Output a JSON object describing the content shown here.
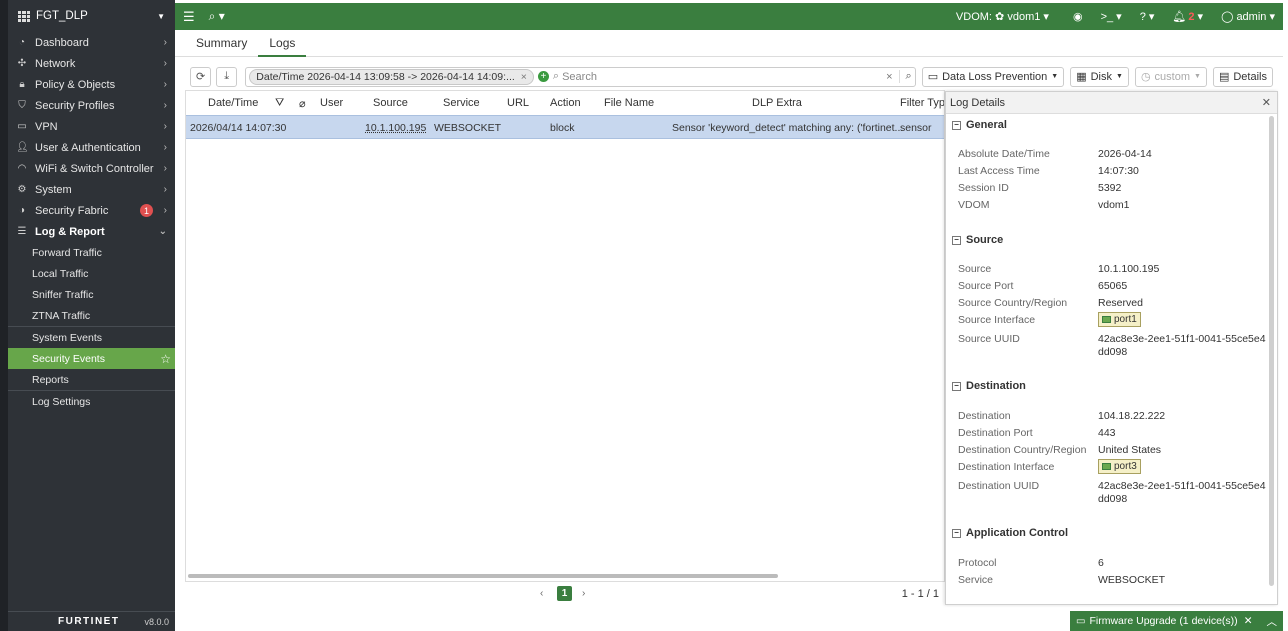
{
  "sidebar": {
    "device": "FGT_DLP",
    "items": [
      {
        "label": "Dashboard",
        "icon": "dashboard-icon"
      },
      {
        "label": "Network",
        "icon": "network-icon"
      },
      {
        "label": "Policy & Objects",
        "icon": "lock-icon"
      },
      {
        "label": "Security Profiles",
        "icon": "shield-icon"
      },
      {
        "label": "VPN",
        "icon": "monitor-icon"
      },
      {
        "label": "User & Authentication",
        "icon": "user-icon"
      },
      {
        "label": "WiFi & Switch Controller",
        "icon": "wifi-icon"
      },
      {
        "label": "System",
        "icon": "gear-icon"
      },
      {
        "label": "Security Fabric",
        "icon": "fabric-icon",
        "badge": "1"
      },
      {
        "label": "Log & Report",
        "icon": "chart-icon"
      }
    ],
    "sub_items": [
      "Forward Traffic",
      "Local Traffic",
      "Sniffer Traffic",
      "ZTNA Traffic",
      "System Events",
      "Security Events",
      "Reports",
      "Log Settings"
    ],
    "brand": "FURTINET",
    "version": "v8.0.0"
  },
  "topbar": {
    "vdom_label": "VDOM:",
    "vdom_value": "vdom1",
    "notification_count": "2",
    "user": "admin"
  },
  "tabs": [
    "Summary",
    "Logs"
  ],
  "toolbar": {
    "filter_chip": "Date/Time 2026-04-14 13:09:58 -> 2026-04-14 14:09:...",
    "search_placeholder": "Search",
    "profile": "Data Loss Prevention",
    "storage": "Disk",
    "time_mode": "custom",
    "details_label": "Details"
  },
  "table": {
    "headers": {
      "datetime": "Date/Time",
      "user": "User",
      "source": "Source",
      "service": "Service",
      "url": "URL",
      "action": "Action",
      "filename": "File Name",
      "dlp_extra": "DLP Extra",
      "filter_type": "Filter Type"
    },
    "rows": [
      {
        "datetime": "2026/04/14 14:07:30",
        "source": "10.1.100.195",
        "service": "WEBSOCKET",
        "action": "block",
        "dlp_extra": "Sensor 'keyword_detect' matching any: ('fortinet...",
        "filter_type": "sensor"
      }
    ]
  },
  "pager": {
    "page": "1",
    "count": "1 - 1 / 1"
  },
  "details": {
    "title": "Log Details",
    "general": {
      "title": "General",
      "rows": [
        {
          "k": "Absolute Date/Time",
          "v": "2026-04-14"
        },
        {
          "k": "Last Access Time",
          "v": "14:07:30"
        },
        {
          "k": "Session ID",
          "v": "5392"
        },
        {
          "k": "VDOM",
          "v": "vdom1"
        }
      ]
    },
    "source": {
      "title": "Source",
      "rows": [
        {
          "k": "Source",
          "v": "10.1.100.195"
        },
        {
          "k": "Source Port",
          "v": "65065"
        },
        {
          "k": "Source Country/Region",
          "v": "Reserved"
        },
        {
          "k": "Source Interface",
          "v": "port1"
        },
        {
          "k": "Source UUID",
          "v": "42ac8e3e-2ee1-51f1-0041-55ce5e4dd098"
        }
      ]
    },
    "destination": {
      "title": "Destination",
      "rows": [
        {
          "k": "Destination",
          "v": "104.18.22.222"
        },
        {
          "k": "Destination Port",
          "v": "443"
        },
        {
          "k": "Destination Country/Region",
          "v": "United States"
        },
        {
          "k": "Destination Interface",
          "v": "port3"
        },
        {
          "k": "Destination UUID",
          "v": "42ac8e3e-2ee1-51f1-0041-55ce5e4dd098"
        }
      ]
    },
    "app": {
      "title": "Application Control",
      "rows": [
        {
          "k": "Protocol",
          "v": "6"
        },
        {
          "k": "Service",
          "v": "WEBSOCKET"
        }
      ]
    }
  },
  "firmware": {
    "label": "Firmware Upgrade (1 device(s))"
  }
}
